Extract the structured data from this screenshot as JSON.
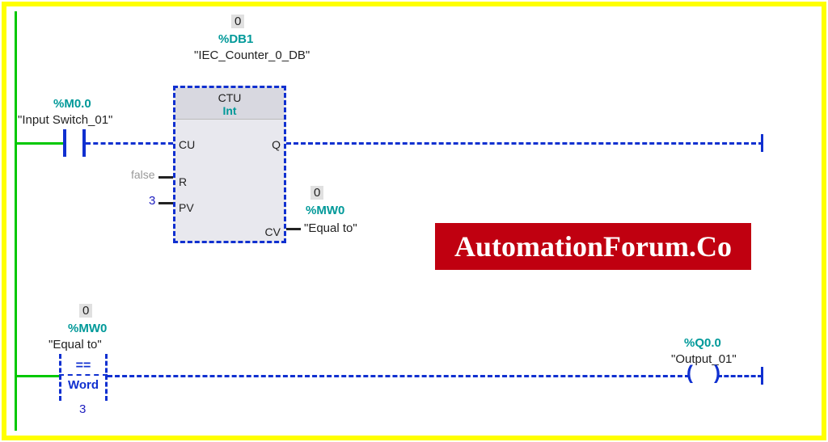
{
  "network1": {
    "input": {
      "address": "%M0.0",
      "name": "\"Input Switch_01\""
    },
    "counter": {
      "instance_value": "0",
      "instance_db": "%DB1",
      "instance_name": "\"IEC_Counter_0_DB\"",
      "type": "CTU",
      "datatype": "Int",
      "pins": {
        "CU": "CU",
        "R": "R",
        "R_value": "false",
        "PV": "PV",
        "PV_value": "3",
        "Q": "Q",
        "CV": "CV",
        "CV_value": "0",
        "CV_addr": "%MW0",
        "CV_name": "\"Equal to\""
      }
    }
  },
  "network2": {
    "compare": {
      "value": "0",
      "address": "%MW0",
      "name": "\"Equal to\"",
      "op": "==",
      "datatype": "Word",
      "operand2": "3"
    },
    "output": {
      "address": "%Q0.0",
      "name": "\"Output_01\""
    }
  },
  "watermark": "AutomationForum.Co"
}
